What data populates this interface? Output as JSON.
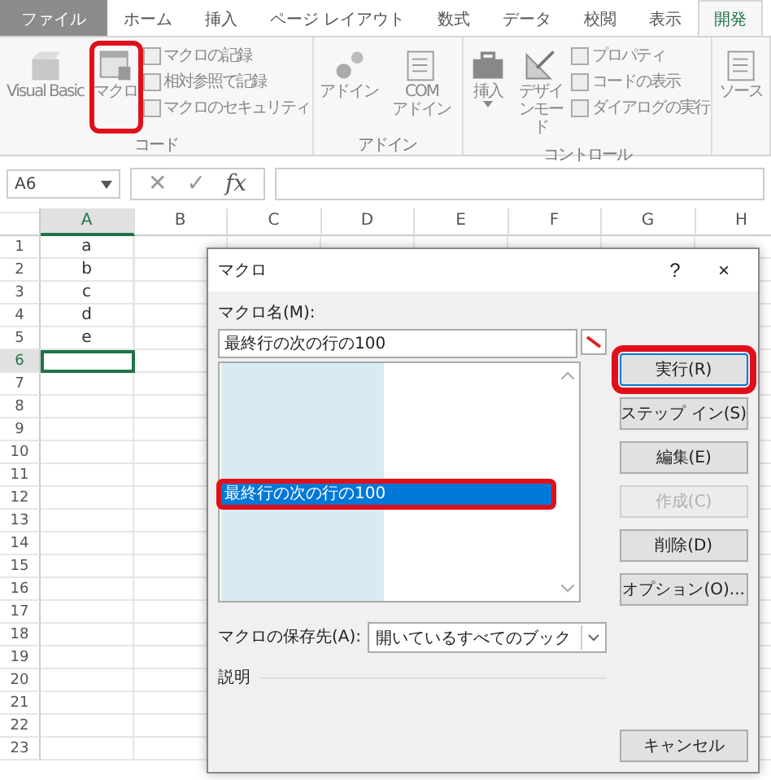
{
  "ribbon_tabs": [
    {
      "label": "ファイル",
      "kind": "file",
      "selected": false
    },
    {
      "label": "ホーム",
      "kind": "tab",
      "selected": false
    },
    {
      "label": "挿入",
      "kind": "tab",
      "selected": false
    },
    {
      "label": "ページ レイアウト",
      "kind": "tab",
      "selected": false
    },
    {
      "label": "数式",
      "kind": "tab",
      "selected": false
    },
    {
      "label": "データ",
      "kind": "tab",
      "selected": false
    },
    {
      "label": "校閲",
      "kind": "tab",
      "selected": false
    },
    {
      "label": "表示",
      "kind": "tab",
      "selected": false
    },
    {
      "label": "開発",
      "kind": "tab",
      "selected": true
    }
  ],
  "ribbon_groups": [
    {
      "label": "コード",
      "large": [
        {
          "label": "Visual Basic",
          "kind": "vb",
          "highlighted": false
        },
        {
          "label": "マクロ",
          "kind": "macro",
          "highlighted": true
        }
      ],
      "small": [
        "マクロの記録",
        "相対参照で記録",
        "マクロのセキュリティ"
      ]
    },
    {
      "label": "アドイン",
      "large": [
        {
          "label": "アドイン",
          "kind": "gear",
          "highlighted": false
        },
        {
          "label": "COM アドイン",
          "kind": "list",
          "highlighted": false
        }
      ]
    },
    {
      "label": "コントロール",
      "large": [
        {
          "label": "挿入",
          "kind": "toolbox",
          "highlighted": false
        },
        {
          "label": "デザインモード",
          "kind": "ruler",
          "highlighted": false
        }
      ],
      "small": [
        "プロパティ",
        "コードの表示",
        "ダイアログの実行"
      ]
    },
    {
      "large": [
        {
          "label": "ソース",
          "kind": "list",
          "highlighted": false
        }
      ]
    }
  ],
  "formula_bar": {
    "name_box": "A6",
    "cancel": "✕",
    "enter": "✓",
    "function": "fx"
  },
  "sheet": {
    "columns": [
      {
        "label": "A",
        "selected": true
      },
      {
        "label": "B",
        "selected": false
      },
      {
        "label": "C",
        "selected": false
      },
      {
        "label": "D",
        "selected": false
      },
      {
        "label": "E",
        "selected": false
      },
      {
        "label": "F",
        "selected": false
      },
      {
        "label": "G",
        "selected": false
      },
      {
        "label": "H",
        "selected": false
      }
    ],
    "rows": [
      {
        "label": "1",
        "selected": false,
        "value": "a"
      },
      {
        "label": "2",
        "selected": false,
        "value": "b"
      },
      {
        "label": "3",
        "selected": false,
        "value": "c"
      },
      {
        "label": "4",
        "selected": false,
        "value": "d"
      },
      {
        "label": "5",
        "selected": false,
        "value": "e"
      },
      {
        "label": "6",
        "selected": true
      },
      {
        "label": "7",
        "selected": false
      },
      {
        "label": "8",
        "selected": false
      },
      {
        "label": "9",
        "selected": false
      },
      {
        "label": "10",
        "selected": false
      },
      {
        "label": "11",
        "selected": false
      },
      {
        "label": "12",
        "selected": false
      },
      {
        "label": "13",
        "selected": false
      },
      {
        "label": "14",
        "selected": false
      },
      {
        "label": "15",
        "selected": false
      },
      {
        "label": "16",
        "selected": false
      },
      {
        "label": "17",
        "selected": false
      },
      {
        "label": "18",
        "selected": false
      },
      {
        "label": "19",
        "selected": false
      },
      {
        "label": "20",
        "selected": false
      },
      {
        "label": "21",
        "selected": false
      },
      {
        "label": "22",
        "selected": false
      },
      {
        "label": "23",
        "selected": false
      }
    ]
  },
  "dialog": {
    "title": "マクロ",
    "help": "?",
    "close": "×",
    "name_label": "マクロ名(M):",
    "name_value": "最終行の次の行の100",
    "macros": [
      {
        "label": "最終行の次の行の100",
        "selected": true,
        "highlighted": true
      }
    ],
    "buttons": [
      {
        "label": "実行(R)",
        "disabled": false,
        "highlighted": true
      },
      {
        "label": "ステップ イン(S)",
        "disabled": false,
        "highlighted": false
      },
      {
        "label": "編集(E)",
        "disabled": false,
        "highlighted": false
      },
      {
        "label": "作成(C)",
        "disabled": true,
        "highlighted": false
      },
      {
        "label": "削除(D)",
        "disabled": false,
        "highlighted": false
      },
      {
        "label": "オプション(O)...",
        "disabled": false,
        "highlighted": false
      }
    ],
    "location_label": "マクロの保存先(A):",
    "location_value": "開いているすべてのブック",
    "description_label": "説明",
    "cancel": "キャンセル"
  }
}
